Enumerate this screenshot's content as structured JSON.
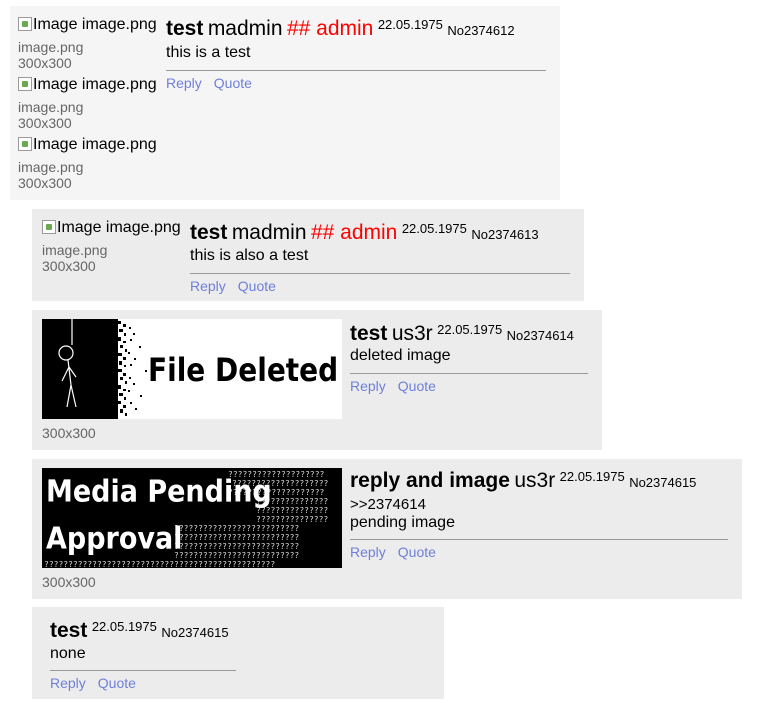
{
  "posts": [
    {
      "subject": "test",
      "name": "madmin",
      "capcode": "## admin",
      "date": "22.05.1975",
      "number": "No2374612",
      "body": "this is a test",
      "actions": {
        "reply": "Reply",
        "quote": "Quote"
      },
      "images": [
        {
          "alt": "Image image.png",
          "filename": "image.png",
          "dims": "300x300"
        },
        {
          "alt": "Image image.png",
          "filename": "image.png",
          "dims": "300x300"
        },
        {
          "alt": "Image image.png",
          "filename": "image.png",
          "dims": "300x300"
        }
      ]
    },
    {
      "subject": "test",
      "name": "madmin",
      "capcode": "## admin",
      "date": "22.05.1975",
      "number": "No2374613",
      "body": "this is also a test",
      "actions": {
        "reply": "Reply",
        "quote": "Quote"
      },
      "images": [
        {
          "alt": "Image image.png",
          "filename": "image.png",
          "dims": "300x300"
        }
      ]
    },
    {
      "subject": "test",
      "name": "us3r",
      "date": "22.05.1975",
      "number": "No2374614",
      "body": "deleted image",
      "actions": {
        "reply": "Reply",
        "quote": "Quote"
      },
      "thumbnail_text": "File Deleted",
      "dims": "300x300"
    },
    {
      "subject": "reply and image",
      "name": "us3r",
      "date": "22.05.1975",
      "number": "No2374615",
      "quote_link": ">>2374614",
      "body": "pending image",
      "actions": {
        "reply": "Reply",
        "quote": "Quote"
      },
      "thumbnail_text_1": "Media Pending",
      "thumbnail_text_2": "Approval",
      "dims": "300x300"
    },
    {
      "subject": "test",
      "date": "22.05.1975",
      "number": "No2374615",
      "body": "none",
      "actions": {
        "reply": "Reply",
        "quote": "Quote"
      }
    }
  ]
}
